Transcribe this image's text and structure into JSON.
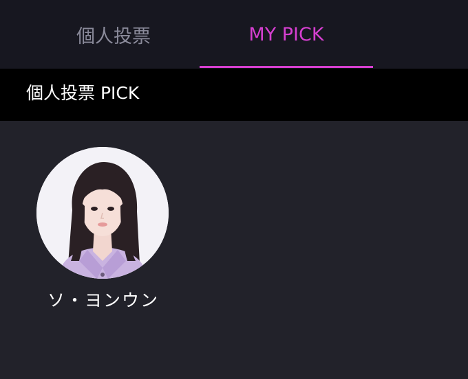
{
  "tabs": {
    "individual_label": "個人投票",
    "mypick_label": "MY PICK",
    "active": "MY PICK"
  },
  "section": {
    "title": "個人投票 PICK"
  },
  "picks": [
    {
      "name": "ソ・ヨンウン"
    }
  ],
  "colors": {
    "accent": "#d63fd0",
    "tabbar_bg": "#171720",
    "header_bg": "#000000",
    "content_bg": "#22222a",
    "inactive_tab_text": "#8a8a9a"
  }
}
